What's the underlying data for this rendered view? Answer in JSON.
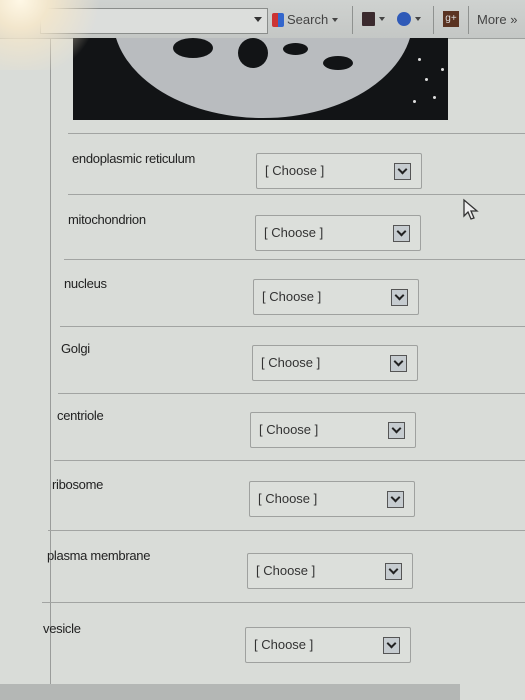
{
  "toolbar": {
    "search_label": "Search",
    "more_label": "More »",
    "icons": [
      "google-search-icon",
      "save-icon",
      "puzzle-icon",
      "google-plus-icon"
    ]
  },
  "quiz": {
    "placeholder": "[ Choose ]",
    "items": [
      {
        "label": "endoplasmic reticulum",
        "value": "[ Choose ]"
      },
      {
        "label": "mitochondrion",
        "value": "[ Choose ]"
      },
      {
        "label": "nucleus",
        "value": "[ Choose ]"
      },
      {
        "label": "Golgi",
        "value": "[ Choose ]"
      },
      {
        "label": "centriole",
        "value": "[ Choose ]"
      },
      {
        "label": "ribosome",
        "value": "[ Choose ]"
      },
      {
        "label": "plasma membrane",
        "value": "[ Choose ]"
      },
      {
        "label": "vesicle",
        "value": "[ Choose ]"
      }
    ]
  }
}
